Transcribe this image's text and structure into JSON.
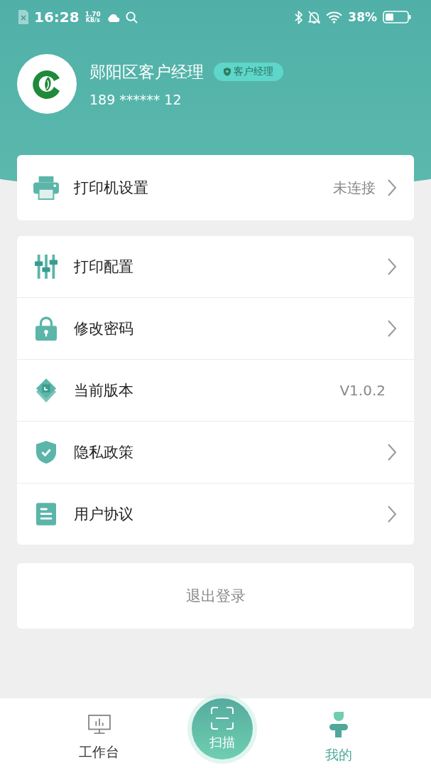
{
  "status_bar": {
    "time": "16:28",
    "speed_value": "1.70",
    "speed_unit": "KB/s",
    "battery": "38%"
  },
  "profile": {
    "name": "郧阳区客户经理",
    "role_badge": "客户经理",
    "phone": "189 ****** 12"
  },
  "printer_card": {
    "label": "打印机设置",
    "value": "未连接",
    "chevron": true
  },
  "settings": [
    {
      "label": "打印配置",
      "chevron": true
    },
    {
      "label": "修改密码",
      "chevron": true
    },
    {
      "label": "当前版本",
      "value": "V1.0.2",
      "chevron": false
    },
    {
      "label": "隐私政策",
      "chevron": true
    },
    {
      "label": "用户协议",
      "chevron": true
    }
  ],
  "logout_button": "退出登录",
  "tab_bar": [
    {
      "kind": "tab",
      "label": "工作台",
      "selected": false
    },
    {
      "kind": "scan",
      "label": "扫描",
      "selected": false
    },
    {
      "kind": "tab",
      "label": "我的",
      "selected": true
    }
  ]
}
